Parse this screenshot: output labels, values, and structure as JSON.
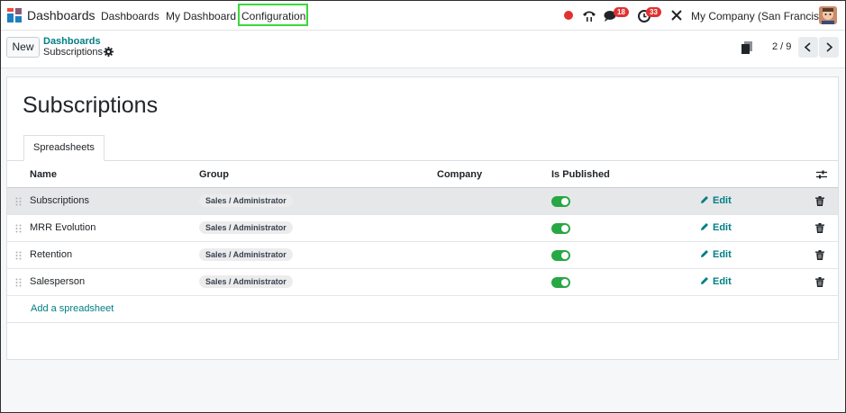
{
  "navbar": {
    "app_name": "Dashboards",
    "menu": [
      "Dashboards",
      "My Dashboard",
      "Configuration"
    ],
    "calls_icon": "phone-icon",
    "messages_badge": "18",
    "activities_badge": "33",
    "company": "My Company (San Francisco)"
  },
  "control_panel": {
    "new_label": "New",
    "breadcrumb_parent": "Dashboards",
    "breadcrumb_current": "Subscriptions",
    "pager": "2 / 9"
  },
  "sheet": {
    "title": "Subscriptions",
    "tab": "Spreadsheets",
    "columns": [
      "Name",
      "Group",
      "Company",
      "Is Published"
    ],
    "rows": [
      {
        "name": "Subscriptions",
        "group": "Sales / Administrator",
        "company": "",
        "published": true,
        "edit": "Edit"
      },
      {
        "name": "MRR Evolution",
        "group": "Sales / Administrator",
        "company": "",
        "published": true,
        "edit": "Edit"
      },
      {
        "name": "Retention",
        "group": "Sales / Administrator",
        "company": "",
        "published": true,
        "edit": "Edit"
      },
      {
        "name": "Salesperson",
        "group": "Sales / Administrator",
        "company": "",
        "published": true,
        "edit": "Edit"
      }
    ],
    "add_line": "Add a spreadsheet"
  },
  "colors": {
    "accent": "#017e84",
    "highlight_box": "#3bd73b",
    "badge": "#e03131",
    "toggle_on": "#28a745"
  }
}
